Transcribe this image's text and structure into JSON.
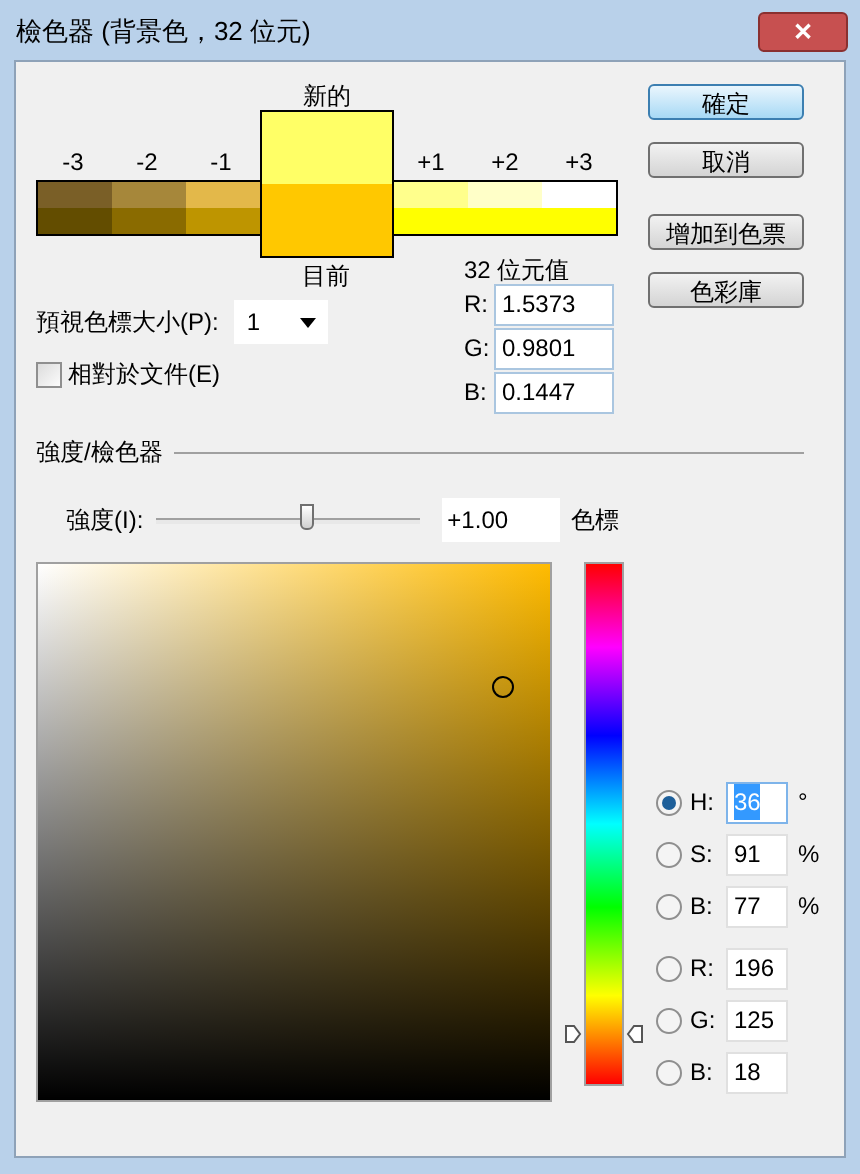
{
  "window": {
    "title": "檢色器 (背景色，32 位元)",
    "close": "✕"
  },
  "preview": {
    "new_label": "新的",
    "current_label": "目前",
    "left_steps": [
      {
        "label": "-3",
        "color": "#7a5f27"
      },
      {
        "label": "-2",
        "color": "#a6873a"
      },
      {
        "label": "-1",
        "color": "#e3b84a"
      }
    ],
    "right_steps": [
      {
        "label": "+1",
        "color": "#ffff8c"
      },
      {
        "label": "+2",
        "color": "#ffffc8"
      },
      {
        "label": "+3",
        "color": "#ffffff"
      }
    ]
  },
  "buttons": [
    {
      "label": "確定",
      "default": true
    },
    {
      "label": "取消",
      "default": false
    },
    {
      "label": "增加到色票",
      "default": false
    },
    {
      "label": "色彩庫",
      "default": false
    }
  ],
  "swatch_size": {
    "label": "預視色標大小(P):",
    "value": "1"
  },
  "relative": {
    "label": "相對於文件(E)",
    "checked": false
  },
  "float_values": {
    "title": "32 位元值",
    "fields": [
      {
        "label": "R:",
        "value": "1.5373"
      },
      {
        "label": "G:",
        "value": "0.9801"
      },
      {
        "label": "B:",
        "value": "0.1447"
      }
    ]
  },
  "section": {
    "title": "強度/檢色器"
  },
  "intensity": {
    "label": "強度(I):",
    "level": 0.58,
    "value": "+1.00",
    "unit": "色標"
  },
  "channels": [
    {
      "label": "H:",
      "value": "36",
      "unit": "°",
      "selected": true
    },
    {
      "label": "S:",
      "value": "91",
      "unit": "%",
      "selected": false
    },
    {
      "label": "B:",
      "value": "77",
      "unit": "%",
      "selected": false
    },
    {
      "label": "R:",
      "value": "196",
      "selected": false
    },
    {
      "label": "G:",
      "value": "125",
      "selected": false
    },
    {
      "label": "B:",
      "value": "18",
      "selected": false
    }
  ]
}
